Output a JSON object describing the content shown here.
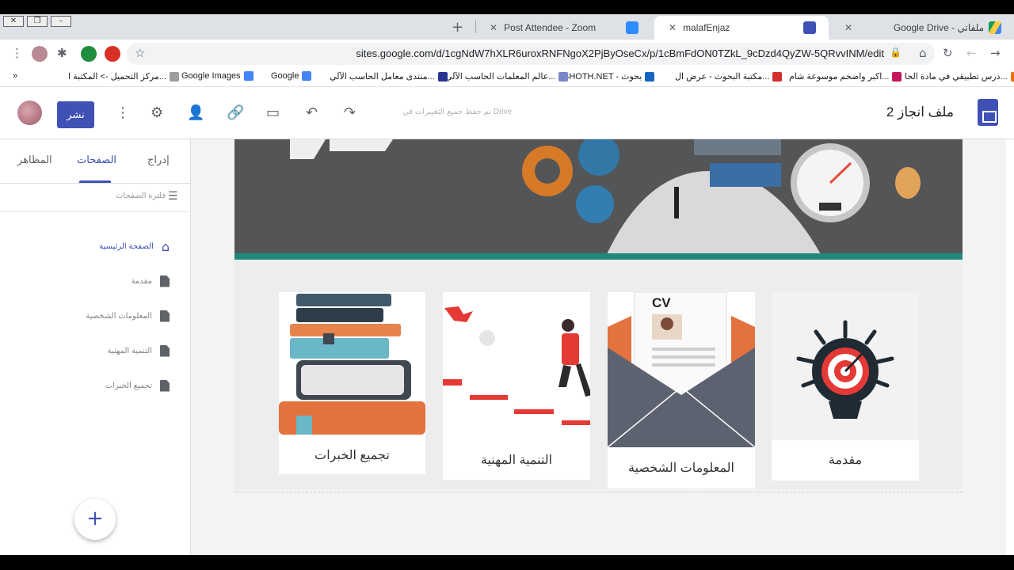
{
  "browser": {
    "tabs": [
      {
        "title": "Post Attendee - Zoom"
      },
      {
        "title": "malafEnjaz"
      },
      {
        "title": "Google Drive - ملفاتي"
      }
    ],
    "url": "sites.google.com/d/1cgNdW7hXLR6uroxRNFNgoX2PjByOseCx/p/1cBmFdON0TZkL_9cDzd4QyZW-5QRvvINM/edit",
    "bookmarks": [
      "درس تطبيقي في مادة الحا...",
      "اكبر واضخم موسوعة شام...",
      "مكتبة البحوث - عرض ال...",
      "BHOTH.NET - بحوث",
      "عالم المعلمات الحاسب الآلي...",
      "منتدى معامل الحاسب الآلي...",
      "Google",
      "Google Images",
      "مركز التحميل -> المكتبة ا...",
      "»"
    ]
  },
  "sites": {
    "title": "ملف انجاز 2",
    "saved_status": "تم حفظ جميع التغييرات في Drive",
    "publish_label": "نشر"
  },
  "panel": {
    "tabs": [
      "إدراج",
      "الصفحات",
      "المظاهر"
    ],
    "filter_placeholder": "فلترة الصفحات",
    "pages": [
      {
        "label": "الصفحة الرئيسية",
        "icon": "home-icon"
      },
      {
        "label": "مقدمة",
        "icon": "document-icon"
      },
      {
        "label": "المعلومات الشخصية",
        "icon": "document-icon"
      },
      {
        "label": "التنمية المهنية",
        "icon": "document-icon"
      },
      {
        "label": "تجميع الخبرات",
        "icon": "document-icon"
      }
    ],
    "fab": "+"
  },
  "cards": [
    {
      "caption": "تجميع الخبرات"
    },
    {
      "caption": "التنمية المهنية"
    },
    {
      "caption": "المعلومات الشخصية",
      "badge": "CV"
    },
    {
      "caption": "مقدمة"
    }
  ],
  "colors": {
    "accent": "#3f51b5",
    "banner": "#545557",
    "stripe": "#1f8a7a"
  }
}
